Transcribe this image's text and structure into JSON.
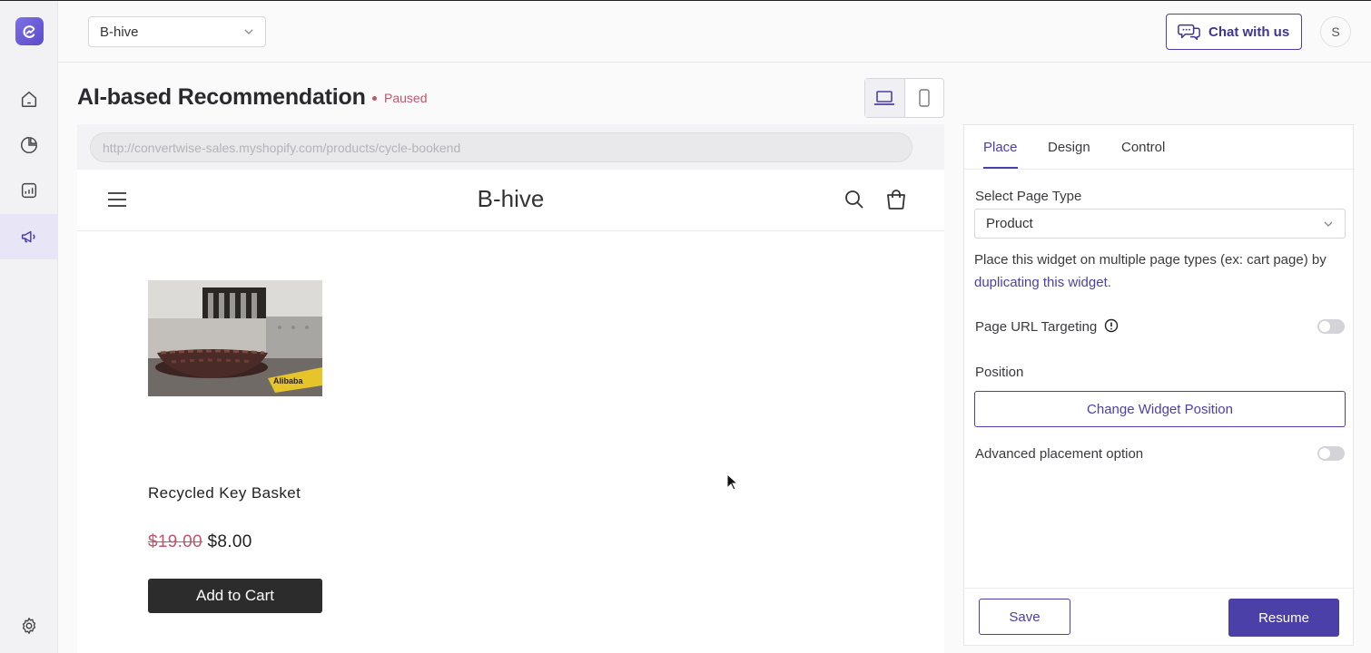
{
  "sidebar": {
    "items": [
      {
        "icon": "home-icon"
      },
      {
        "icon": "pie-chart-icon"
      },
      {
        "icon": "analytics-icon"
      },
      {
        "icon": "megaphone-icon",
        "active": true
      }
    ],
    "bottom_icon": "gear-icon"
  },
  "topbar": {
    "store_select": "B-hive",
    "chat_label": "Chat with us",
    "avatar_initial": "S"
  },
  "header": {
    "title": "AI-based Recommendation",
    "status": "Paused",
    "status_color": "#c0566b"
  },
  "preview": {
    "url": "http://convertwise-sales.myshopify.com/products/cycle-bookend",
    "shop_name": "B-hive",
    "product": {
      "name": "Recycled Key Basket",
      "old_price": "$19.00",
      "new_price": "$8.00",
      "button": "Add to Cart",
      "image_label": "Alibaba"
    }
  },
  "panel": {
    "tabs": [
      {
        "label": "Place",
        "active": true
      },
      {
        "label": "Design"
      },
      {
        "label": "Control"
      }
    ],
    "page_type_label": "Select Page Type",
    "page_type_value": "Product",
    "help_text": "Place this widget on multiple page types (ex: cart page) by",
    "help_link": "duplicating this widget.",
    "url_targeting_label": "Page URL Targeting",
    "url_targeting_on": false,
    "position_label": "Position",
    "position_button": "Change Widget Position",
    "advanced_label": "Advanced placement option",
    "advanced_on": false,
    "save_label": "Save",
    "resume_label": "Resume"
  },
  "colors": {
    "accent": "#4b3fa8",
    "status": "#c0566b"
  }
}
